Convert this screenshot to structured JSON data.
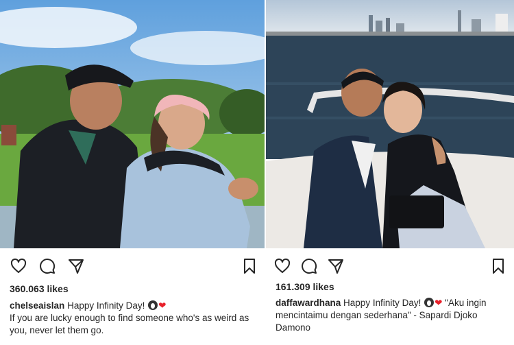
{
  "posts": [
    {
      "likes": "360.063 likes",
      "username": "chelseaislan",
      "caption_text": "Happy Infinity Day!",
      "caption_emoji": "❤",
      "caption_more": "If you are lucky enough to find someone who's as weird as you, never let them go.",
      "photo": {
        "scene": "couple-in-park",
        "colors": {
          "sky": "#8ec1e6",
          "grass": "#5f9a3a",
          "trees": "#3f6b2c",
          "jacket_man": "#1c1f25",
          "jacket_woman": "#a8c2dc"
        }
      }
    },
    {
      "likes": "161.309 likes",
      "username": "daffawardhana",
      "caption_text": "Happy Infinity Day!",
      "caption_emoji": "❤",
      "caption_more": "\"Aku ingin mencintaimu dengan sederhana\" - Sapardi Djoko Damono",
      "photo": {
        "scene": "couple-on-boat",
        "colors": {
          "sky": "#b9cde0",
          "water": "#2d4458",
          "boat": "#e9e6e2",
          "jacket_man": "#1e2d44"
        }
      }
    }
  ],
  "icons": {
    "like": "heart-outline-icon",
    "comment": "comment-bubble-icon",
    "share": "paper-plane-icon",
    "save": "bookmark-icon"
  },
  "colors": {
    "text": "#262626",
    "heart": "#e8202a",
    "background": "#ffffff"
  }
}
